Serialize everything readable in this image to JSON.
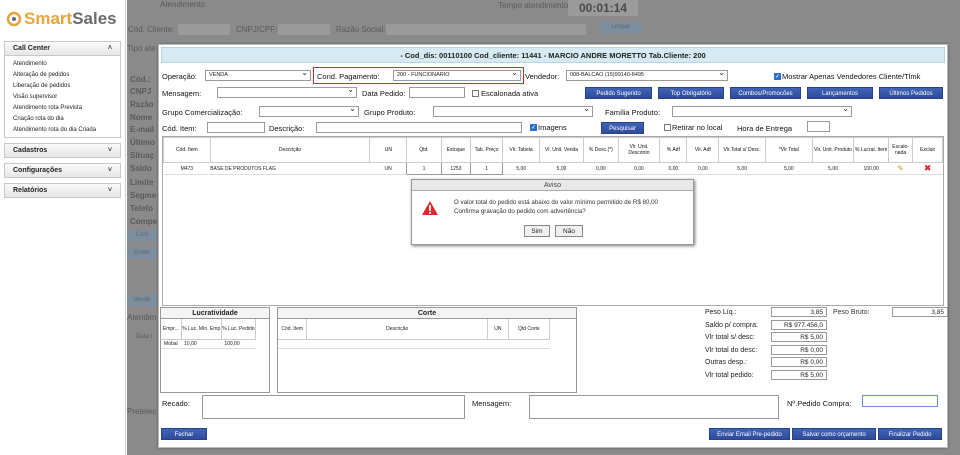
{
  "app": {
    "logo_a": "Smart",
    "logo_b": "Sales"
  },
  "sidebar": {
    "call_center": {
      "label": "Call Center",
      "items": [
        "Atendimento",
        "Alteração de pedidos",
        "Liberação de pedidos",
        "Visão supervisor",
        "Atendimento rota Prevista",
        "Criação rota do dia",
        "Atendimento rota do dia Criada"
      ]
    },
    "cadastros": "Cadastros",
    "configuracoes": "Configurações",
    "relatorios": "Relatórios"
  },
  "background": {
    "atendimento": "Atendimento",
    "tempo": "Tempo atendimento",
    "timer": "00:01:14",
    "cod_cliente": "Cód. Cliente:",
    "cnpj": "CNPJ/CPF:",
    "razao": "Razão Social:",
    "limpar": "Limpar",
    "tipo": "Tipo ate",
    "cod": "Cód.:",
    "cnpj2": "CNPJ",
    "razao2": "Razão",
    "nome": "Nome",
    "email": "E-mail",
    "ultimo": "Último",
    "situac": "Situaç",
    "saldo": "Saldo",
    "limite": "Limite",
    "segme": "Segme",
    "telefo": "Telefo",
    "compe": "Compe",
    "cont": "Cont",
    "ender": "Ender",
    "vende": "Vende",
    "atend": "Atendim",
    "data": "Data l",
    "pretel": "Pretelec"
  },
  "modal": {
    "title": "- Cod_dis: 00110100 Cod_cliente: 11441 - MARCIO ANDRE MORETTO Tab.Cliente: 200",
    "operacao_label": "Operação:",
    "operacao_value": "VENDA",
    "cond_label": "Cond. Pagamento:",
    "cond_value": "200 - FUNCIONARIO",
    "vendedor_label": "Vendedor:",
    "vendedor_value": "008-BALCAO (15)99140-8495",
    "mostrar_label": "Mostrar Apenas Vendedores Cliente/Tlmk",
    "mensagem_label": "Mensagem:",
    "data_pedido_label": "Data Pedido:",
    "escalonada_label": "Escalonada ativa",
    "buttons": {
      "pedido_sugerido": "Pedido Sugerido",
      "top_obrigatorio": "Top Obrigatório",
      "combos": "Combos/Promocões",
      "lancamentos": "Lançamentos",
      "ultimos": "Últimos Pedidos",
      "pesquisar": "Pesquisar",
      "fechar": "Fechar",
      "enviar_email": "Enviar Email Pre-pedido",
      "salvar": "Salvar como orçamento",
      "finalizar": "Finalizar Pedido"
    },
    "grupo_com_label": "Grupo Comercialização:",
    "grupo_prod_label": "Grupo Produto:",
    "familia_label": "Família Produto:",
    "cod_item_label": "Cód. Item:",
    "descricao_label": "Descrição:",
    "imagens_label": "Imagens",
    "retirar_label": "Retirar no local",
    "hora_label": "Hora de Entrega",
    "grid": {
      "headers": [
        "Cód. Item",
        "Descrição",
        "UN",
        "Qtd.",
        "Estoque",
        "Tab. Preço",
        "Vlr. Tabela",
        "Vl. Unit. Venda",
        "% Desc.(*)",
        "Vlr. Unit. Desconto",
        "% Adf",
        "Vlr. Adf",
        "Vlr.Total s/ Desc.",
        "*Vlr Total",
        "Vlr. Unit. Produto",
        "% Lucrat. Item",
        "Escalo-nada",
        "Excluir"
      ],
      "row": [
        "M473",
        "BASE DE PRODUTOS FLAG",
        "UN",
        "1",
        "1253",
        "1",
        "5,00",
        "5,00",
        "0,00",
        "0,00",
        "0,00",
        "0,00",
        "5,00",
        "5,00",
        "5,00",
        "100,00"
      ]
    },
    "aviso": {
      "title": "Aviso",
      "line1": "O valor total do pedido está abaixo do valor mínimo permitido de R$ 80,00",
      "line2": "Confirma gravação do pedido com advertência?",
      "sim": "Sim",
      "nao": "Não"
    },
    "lucratividade": {
      "title": "Lucratividade",
      "headers": [
        "Empr...",
        "% Luc. Mín. Emp",
        "% Luc. Pedido"
      ],
      "row": [
        "Mobal",
        "10,00",
        "100,00"
      ]
    },
    "corte": {
      "title": "Corte",
      "headers": [
        "Cód. Item",
        "Descrição",
        "UN",
        "Qtd Corte"
      ]
    },
    "totais": [
      {
        "label": "Peso Líq.:",
        "value": "3,85"
      },
      {
        "label": "Saldo p/ compra:",
        "value": "R$ 977.456,0"
      },
      {
        "label": "Vlr total s/ desc:",
        "value": "R$ 5,00"
      },
      {
        "label": "Vlr total do desc:",
        "value": "R$ 0,00"
      },
      {
        "label": "Outras desp.:",
        "value": "R$ 0,00"
      },
      {
        "label": "Vlr total pedido:",
        "value": "R$ 5,00"
      }
    ],
    "peso_bruto_label": "Peso Bruto:",
    "peso_bruto_value": "3,85",
    "recado_label": "Recado:",
    "mensagem2_label": "Mensagem:",
    "npedido_label": "Nº.Pedido Compra:"
  },
  "colors": {
    "accent": "#2d4c98",
    "highlight": "#e0262e",
    "titlebar": "#d6eaf3"
  }
}
